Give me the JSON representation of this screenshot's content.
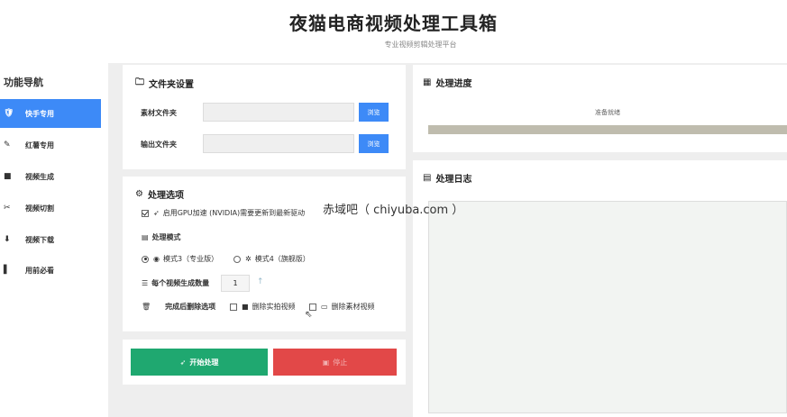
{
  "header": {
    "title": "夜猫电商视频处理工具箱",
    "subtitle": "专业视频剪辑处理平台"
  },
  "sidebar": {
    "title": "功能导航",
    "items": [
      {
        "label": "快手专用",
        "icon": "shield-icon",
        "glyph": "🛡",
        "active": true
      },
      {
        "label": "红薯专用",
        "icon": "pencil-icon",
        "glyph": "✎",
        "active": false
      },
      {
        "label": "视频生成",
        "icon": "video-icon",
        "glyph": "■",
        "active": false
      },
      {
        "label": "视频切割",
        "icon": "scissors-icon",
        "glyph": "✂",
        "active": false
      },
      {
        "label": "视频下载",
        "icon": "download-icon",
        "glyph": "⬇",
        "active": false
      },
      {
        "label": "用前必看",
        "icon": "book-icon",
        "glyph": "▌",
        "active": false
      }
    ]
  },
  "folder_panel": {
    "title": "文件夹设置",
    "source_label": "素材文件夹",
    "source_value": "",
    "source_browse": "浏览",
    "output_label": "输出文件夹",
    "output_value": "",
    "output_browse": "浏览"
  },
  "options_panel": {
    "title": "处理选项",
    "gpu_label": "启用GPU加速 (NVIDIA)需要更新到最新驱动",
    "gpu_checked": true,
    "mode_label": "处理模式",
    "mode3_label": "模式3（专业版）",
    "mode4_label": "模式4（旗舰版）",
    "selected_mode": "mode3",
    "count_label": "每个视频生成数量",
    "count_value": "1",
    "delete_label": "完成后删除选项",
    "delete_shot_label": "删除实拍视频",
    "delete_material_label": "删除素材视频"
  },
  "actions": {
    "start_label": "开始处理",
    "stop_label": "停止"
  },
  "progress_panel": {
    "title": "处理进度",
    "status": "准备就绪",
    "progress": 0
  },
  "log_panel": {
    "title": "处理日志",
    "content": ""
  },
  "watermark": "赤域吧（ chiyuba.com ）",
  "colors": {
    "accent": "#3d8af7",
    "start": "#1fa870",
    "stop": "#e24848"
  }
}
